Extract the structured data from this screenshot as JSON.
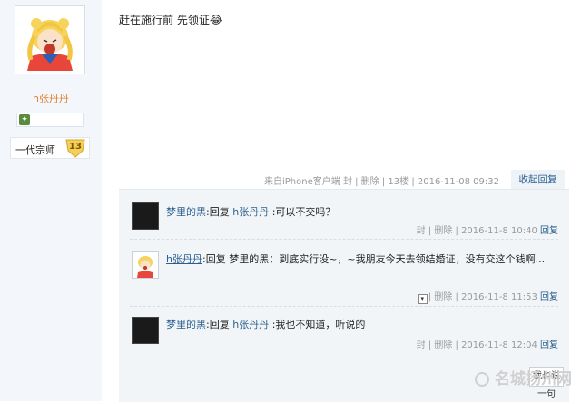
{
  "profile": {
    "username": "h张丹丹",
    "rank_title": "一代宗师",
    "level": "13"
  },
  "post": {
    "text": "赶在施行前 先领证😂",
    "meta": {
      "source": "来自iPhone客户端",
      "ban": "封",
      "delete": "删除",
      "floor": "13楼",
      "time": "2016-11-08 09:32"
    },
    "collapse_label": "收起回复"
  },
  "replies": [
    {
      "user": "梦里的黑",
      "reply_word": "回复",
      "to": "h张丹丹",
      "text": " :可以不交吗？",
      "ban": "封",
      "delete": "删除",
      "time": "2016-11-8 10:40",
      "reply_label": "回复"
    },
    {
      "user": "h张丹丹",
      "reply_word": "回复",
      "to": "梦里的黑",
      "text": "：到底实行没~，~我朋友今天去领结婚证，没有交这个钱啊...",
      "delete": "删除",
      "time": "2016-11-8 11:53",
      "reply_label": "回复"
    },
    {
      "user": "梦里的黑",
      "reply_word": "回复",
      "to": "h张丹丹",
      "text": " :我也不知道，听说的",
      "ban": "封",
      "delete": "删除",
      "time": "2016-11-8 12:04",
      "reply_label": "回复"
    }
  ],
  "say_button_label": "我也说一句",
  "watermark": "名城扬州网"
}
